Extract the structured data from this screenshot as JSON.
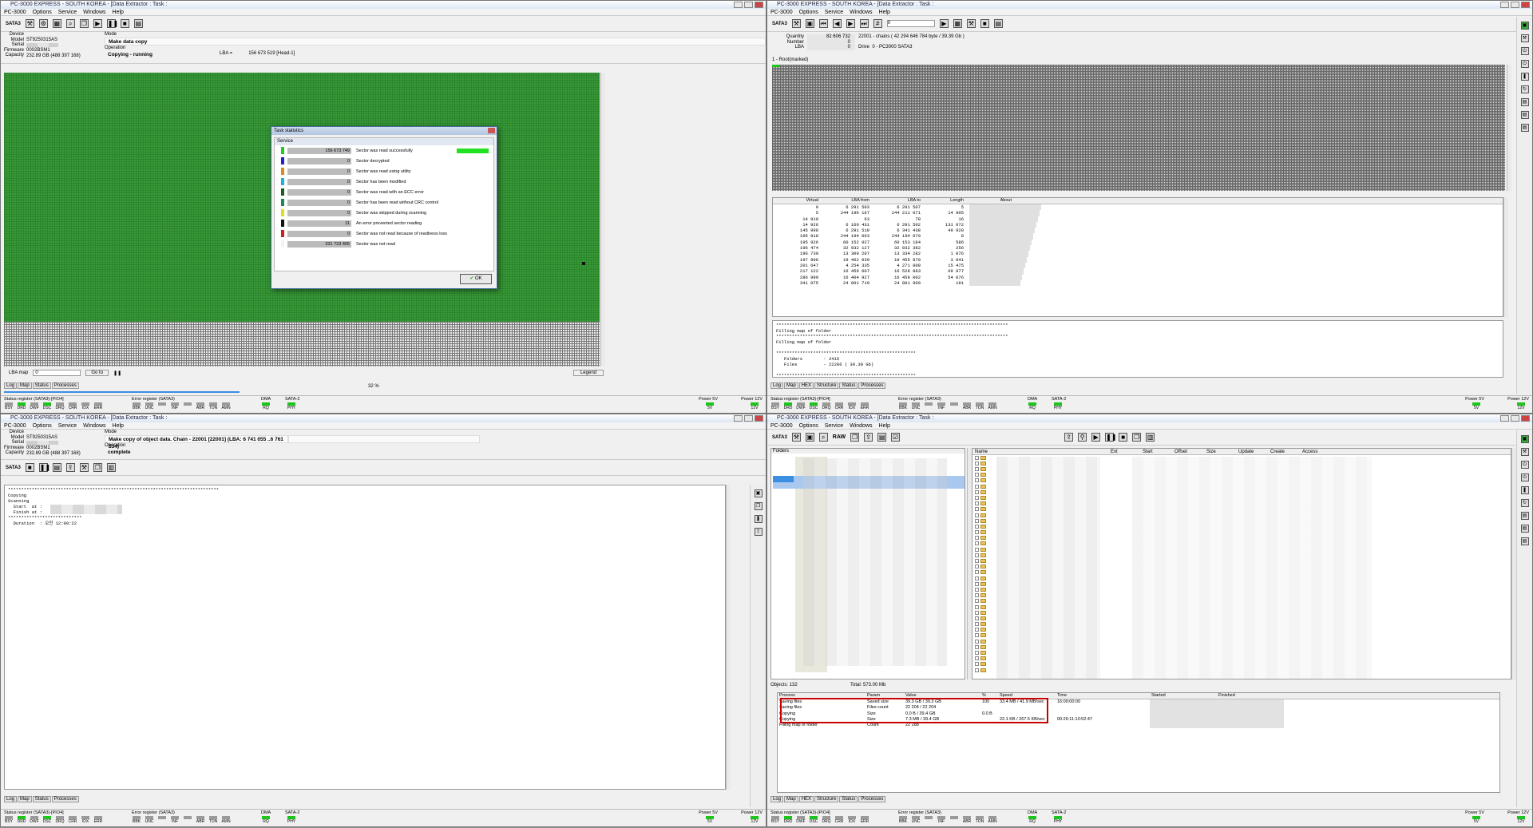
{
  "colors": {
    "map_green": "#3a9a3a",
    "led_on": "#1cc41c",
    "highlight_box": "#c80000",
    "selection": "#a8c8f0"
  },
  "windows": {
    "title": "PC-3000 EXPRESS - SOUTH KOREA - [Data Extractor : Task :",
    "menu": [
      "PC-3000",
      "Options",
      "Service",
      "Windows",
      "Help"
    ],
    "menu_tr": [
      "PC-3000",
      "Options",
      "Service",
      "Windows",
      "Help"
    ],
    "interface": "SATA3"
  },
  "device": {
    "labels": [
      "Device",
      "Model",
      "Serial",
      "Firmware",
      "Capacity"
    ],
    "model": "ST9250315AS",
    "firmware": "0002BSM1",
    "capacity": "232.89 GB (488 397 168)",
    "mode_label": "Mode",
    "operation_label": "Operation"
  },
  "tl": {
    "mode": "Make data copy",
    "operation": "Copying - running",
    "lba_label": "LBA =",
    "lba_value": "156 673 519  [Head-1]",
    "lba_map_label": "LBA map",
    "lba_map_value": "0",
    "goto": "Go to",
    "legend": "Legend",
    "progress": "32 %",
    "tabs": [
      "Log",
      "Map",
      "Status",
      "Processes"
    ]
  },
  "dialog": {
    "title": "Task statistics",
    "section": "Service",
    "ok": "OK",
    "rows": [
      {
        "color": "#22cc22",
        "count": "156 673 749",
        "label": "Sector was read successfully"
      },
      {
        "color": "#2222cc",
        "count": "0",
        "label": "Sector decrypted"
      },
      {
        "color": "#e08a1a",
        "count": "0",
        "label": "Sector was read using utility"
      },
      {
        "color": "#1ab0e0",
        "count": "0",
        "label": "Sector has been modified"
      },
      {
        "color": "#1a5e1a",
        "count": "0",
        "label": "Sector was read with an ECC error"
      },
      {
        "color": "#1a8a5a",
        "count": "0",
        "label": "Sector has been read without CRC control"
      },
      {
        "color": "#e0e01a",
        "count": "0",
        "label": "Sector was skipped during scanning"
      },
      {
        "color": "#111111",
        "count": "11",
        "label": "An error prevented sector reading"
      },
      {
        "color": "#cc2222",
        "count": "0",
        "label": "Sector was not read because of readiness loss"
      },
      {
        "color": "#f4f4f4",
        "count": "331 723 405",
        "label": "Sector was not read"
      }
    ]
  },
  "tr": {
    "info_labels": [
      "Quantity",
      "Number",
      "LBA"
    ],
    "quantity": "82 606 732",
    "chains": "22001 - chains  ( 42 294 646 784 byte / 39.39 Gb )",
    "number": "0",
    "lba": "0",
    "drive_label": "Drive",
    "drive": "0 - PC3000 SATA3",
    "tree_label": "1 - Root(marked)",
    "columns": [
      "Virtual",
      "LBA from",
      "LBA to",
      "Length",
      "About"
    ],
    "rows": [
      [
        "0",
        "6 291 503",
        "6 291 507",
        "5"
      ],
      [
        "5",
        "244 196 167",
        "244 211 071",
        "14 905"
      ],
      [
        "14 910",
        "63",
        "78",
        "16"
      ],
      [
        "14 926",
        "6 160 431",
        "6 291 502",
        "131 072"
      ],
      [
        "145 998",
        "6 291 519",
        "6 341 438",
        "49 920"
      ],
      [
        "195 918",
        "244 194 063",
        "244 194 070",
        "8"
      ],
      [
        "195 926",
        "60 152 027",
        "60 153 184",
        "586"
      ],
      [
        "196 474",
        "32 032 127",
        "32 032 382",
        "256"
      ],
      [
        "196 730",
        "13 300 207",
        "13 334 282",
        "1 076"
      ],
      [
        "197 806",
        "19 462 039",
        "19 455 879",
        "3 841"
      ],
      [
        "201 647",
        "4 254 335",
        "4 271 809",
        "15 475"
      ],
      [
        "217 122",
        "16 459 007",
        "16 528 883",
        "69 877"
      ],
      [
        "286 999",
        "16 404 927",
        "16 459 002",
        "54 076"
      ],
      [
        "341 075",
        "24 801 719",
        "24 801 909",
        "191"
      ]
    ],
    "log": "****************************************************************************************\nFilling map of folder\n****************************************************************************************\nFilling map of folder\n\n*****************************************************\n   Folders        - 2415\n   Files          - 22286 ( 39.39 Gb)\n\n*****************************************************",
    "tabs": [
      "Log",
      "Map",
      "HEX",
      "Structure",
      "Status",
      "Processes"
    ]
  },
  "bl": {
    "mode": "Make copy of object data. Chain - 22001 [22001] (LBA: 6 741 055 ..6 761 534)",
    "operation": "complete",
    "log": "********************************************************************************\nCopying\nScanning\n  Start  at :\n  Finish at :\n****************************\n  Duration  : 오전 12:00:22",
    "tabs": [
      "Log",
      "Map",
      "Status",
      "Processes"
    ]
  },
  "br": {
    "folders_label": "Folders",
    "raw": "RAW",
    "file_columns": [
      "Name",
      "Ext",
      "Start",
      "Offset",
      "Size",
      "Update",
      "Create",
      "Access"
    ],
    "objects": "Objects: 132",
    "total": "Total: 573.00 Mb",
    "proc_columns": [
      "Process",
      "Param",
      "Value",
      "%",
      "Speed",
      "Time",
      "Started",
      "Finished"
    ],
    "proc_rows": [
      [
        "Saving files",
        "Saved size",
        "39.3 GB / 39.3 GB",
        "100",
        "33.4 MB / 41.9 MB/sec",
        "16:00:00:00",
        "",
        ""
      ],
      [
        "Saving files",
        "Files count",
        "22 204 / 22 204",
        "",
        "",
        "",
        "",
        ""
      ],
      [
        "Copying",
        "Size",
        "0.0 B / 39.4 GB",
        "0.0 B",
        "",
        "",
        "",
        ""
      ],
      [
        "Copying",
        "Size",
        "7.3 MB / 39.4 GB",
        "",
        "22.1 KB / 267.5 KB/sec",
        "00:26:11:10:52:47",
        "",
        ""
      ],
      [
        "Filling map of folder",
        "Count",
        "22 288",
        "",
        "",
        "",
        "",
        ""
      ]
    ],
    "tabs": [
      "Log",
      "Map",
      "HEX",
      "Structure",
      "Status",
      "Processes"
    ]
  },
  "statusbar": {
    "status_title": "Status register (SATA3)-[PIO4]",
    "error_title": "Error register (SATA3)",
    "dma": "DMA",
    "sata": "SATA-2",
    "power5": "Power 5V",
    "power12": "Power 12V",
    "status_leds": [
      "BSY",
      "DRD",
      "DWF",
      "DSC",
      "DRQ",
      "CRR",
      "IDX",
      "ERR"
    ],
    "error_leds": [
      "BBK",
      "UNC",
      "",
      "INF",
      "",
      "ABR",
      "TON",
      "AMN"
    ],
    "dma_led": "RQ",
    "sata_led": "PHY",
    "v5": "5V",
    "v12": "12V"
  }
}
